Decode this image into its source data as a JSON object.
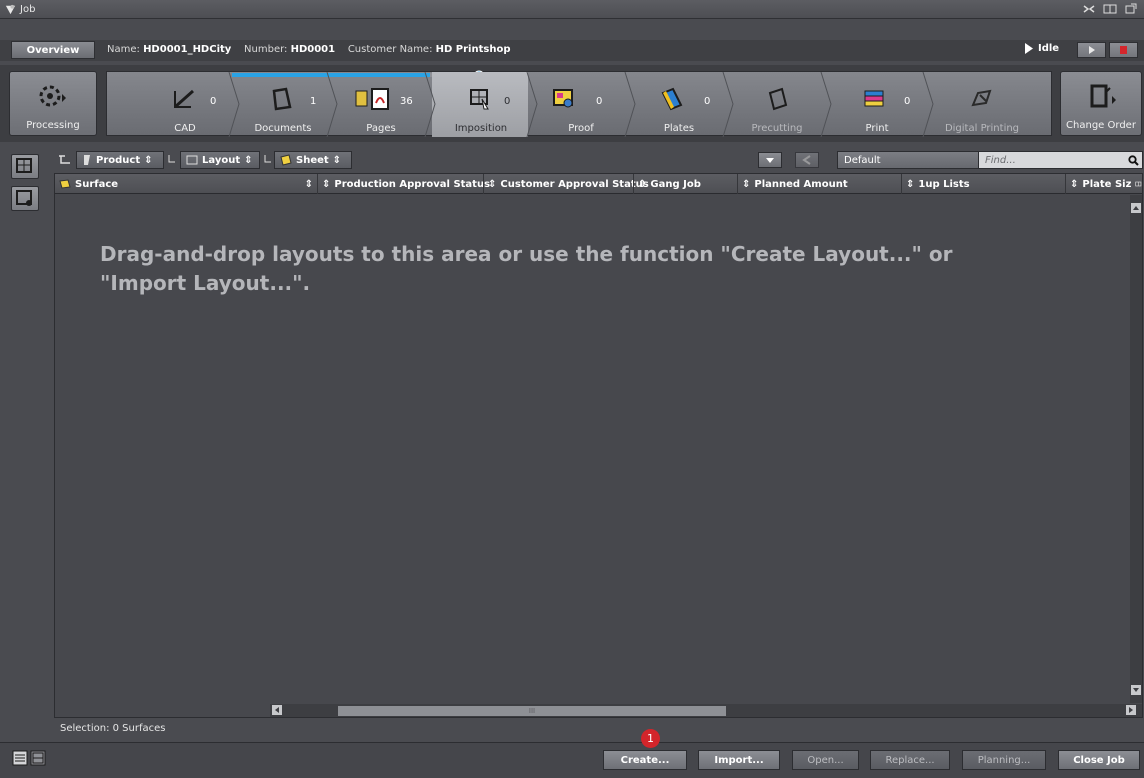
{
  "window": {
    "title": "Job"
  },
  "infobar": {
    "overview_label": "Overview",
    "name_label": "Name:",
    "name_value": "HD0001_HDCity",
    "number_label": "Number:",
    "number_value": "HD0001",
    "customer_label": "Customer Name:",
    "customer_value": "HD Printshop",
    "status": "Idle"
  },
  "workflow": {
    "left": {
      "label": "Processing"
    },
    "right": {
      "label": "Change Order"
    },
    "steps": [
      {
        "label": "CAD",
        "count": "0"
      },
      {
        "label": "Documents",
        "count": "1"
      },
      {
        "label": "Pages",
        "count": "36"
      },
      {
        "label": "Imposition",
        "count": "0"
      },
      {
        "label": "Proof",
        "count": "0"
      },
      {
        "label": "Plates",
        "count": "0"
      },
      {
        "label": "Precutting",
        "count": ""
      },
      {
        "label": "Print",
        "count": "0"
      },
      {
        "label": "Digital Printing",
        "count": ""
      }
    ]
  },
  "toolbar": {
    "product_label": "Product",
    "layout_label": "Layout",
    "sheet_label": "Sheet",
    "view_combo": "Default",
    "find_placeholder": "Find..."
  },
  "table": {
    "columns": [
      "Surface",
      "Production Approval Status",
      "Customer Approval Status",
      "Gang Job",
      "Planned Amount",
      "1up Lists",
      "Plate Siz"
    ],
    "empty_message": "Drag-and-drop layouts to this area or use the function \"Create Layout...\" or \"Import Layout...\".",
    "scroll_marker": "III"
  },
  "selection_text": "Selection:  0 Surfaces",
  "bottom": {
    "badge": "1",
    "create": "Create...",
    "import": "Import...",
    "open": "Open...",
    "replace": "Replace...",
    "planning": "Planning...",
    "close": "Close Job"
  },
  "colors": {
    "accent": "#2aa3e6",
    "badge": "#d3252b",
    "background": "#4a4b50"
  }
}
